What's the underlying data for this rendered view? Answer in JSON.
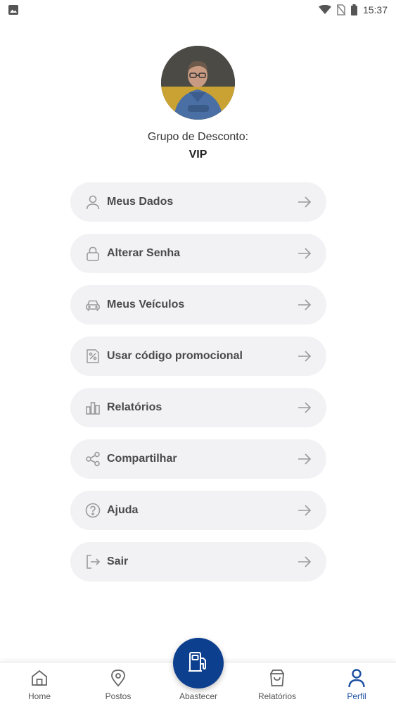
{
  "status_bar": {
    "time": "15:37",
    "icons": [
      "image-icon",
      "wifi-icon",
      "no-sim-icon",
      "battery-icon"
    ]
  },
  "profile": {
    "group_label": "Grupo de Desconto:",
    "group_value": "VIP"
  },
  "menu": {
    "items": [
      {
        "label": "Meus Dados",
        "icon": "user-icon"
      },
      {
        "label": "Alterar Senha",
        "icon": "lock-icon"
      },
      {
        "label": "Meus Veículos",
        "icon": "car-icon"
      },
      {
        "label": "Usar código promocional",
        "icon": "percent-icon"
      },
      {
        "label": "Relatórios",
        "icon": "bar-chart-icon"
      },
      {
        "label": "Compartilhar",
        "icon": "share-icon"
      },
      {
        "label": "Ajuda",
        "icon": "help-icon"
      },
      {
        "label": "Sair",
        "icon": "logout-icon"
      }
    ]
  },
  "bottom_nav": {
    "items": [
      {
        "label": "Home",
        "icon": "home-icon"
      },
      {
        "label": "Postos",
        "icon": "location-pin-icon"
      },
      {
        "label": "Abastecer",
        "icon": "fuel-pump-icon"
      },
      {
        "label": "Relatórios",
        "icon": "shopping-bag-icon"
      },
      {
        "label": "Perfil",
        "icon": "user-icon"
      }
    ],
    "active": "Perfil"
  },
  "colors": {
    "accent": "#0d3f8f",
    "active_nav": "#1c4fa0",
    "menu_bg": "#f2f1f4",
    "menu_text": "#4a4a4a"
  }
}
